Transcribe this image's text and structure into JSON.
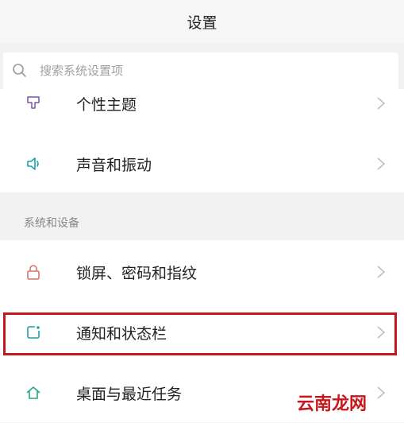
{
  "header": {
    "title": "设置"
  },
  "search": {
    "placeholder": "搜索系统设置项"
  },
  "rows": [
    {
      "label": "个性主题",
      "icon": "theme-icon"
    },
    {
      "label": "声音和振动",
      "icon": "speaker-icon"
    }
  ],
  "section": {
    "header": "系统和设备",
    "rows": [
      {
        "label": "锁屏、密码和指纹",
        "icon": "lock-icon"
      },
      {
        "label": "通知和状态栏",
        "icon": "notification-icon"
      },
      {
        "label": "桌面与最近任务",
        "icon": "home-icon"
      }
    ]
  },
  "watermark": "云南龙网",
  "colors": {
    "accent": "#1e9fae",
    "highlight": "#c8161d",
    "background": "#f2f2f2",
    "card": "#ffffff"
  }
}
